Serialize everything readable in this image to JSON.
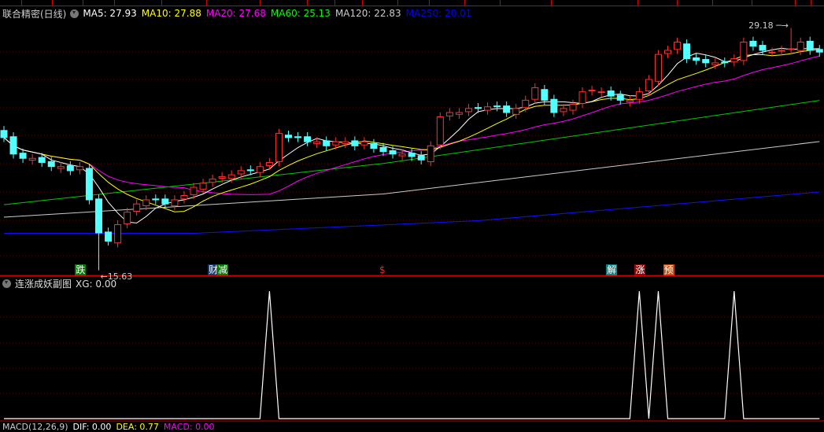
{
  "header": {
    "stock_name": "联合精密(日线)",
    "ma": [
      {
        "label": "MA5: 27.93",
        "color": "#ffffff"
      },
      {
        "label": "MA10: 27.88",
        "color": "#ffff00"
      },
      {
        "label": "MA20: 27.68",
        "color": "#ff00ff"
      },
      {
        "label": "MA60: 25.13",
        "color": "#00ff00"
      },
      {
        "label": "MA120: 22.83",
        "color": "#cccccc"
      },
      {
        "label": "MA250: 20.01",
        "color": "#0000ff"
      }
    ]
  },
  "price_marks": {
    "high": "29.18",
    "low": "15.63",
    "high_index": 83,
    "low_index": 10
  },
  "signals": [
    {
      "text": "跌",
      "bg": "#0a7a0a",
      "index": 8
    },
    {
      "text": "财",
      "bg": "#1a3a6a",
      "index": 22
    },
    {
      "text": "减",
      "bg": "#0a7a0a",
      "index": 23
    },
    {
      "text": "$",
      "bg": "transparent",
      "color": "#ff2020",
      "index": 40
    },
    {
      "text": "解",
      "bg": "#108080",
      "index": 64
    },
    {
      "text": "涨",
      "bg": "#8a0a0a",
      "index": 67
    },
    {
      "text": "预",
      "bg": "#c05010",
      "index": 70
    }
  ],
  "sub_chart": {
    "title": "连涨成妖副图",
    "value_label": "XG: 0.00",
    "xg_on_indices": [
      28,
      67,
      69,
      77
    ]
  },
  "bottom_bar": {
    "items": [
      {
        "label": "MACD(12,26,9)",
        "color": "#cccccc"
      },
      {
        "label": "DIF: 0.00",
        "color": "#ffffff"
      },
      {
        "label": "DEA: 0.77",
        "color": "#ffff00"
      },
      {
        "label": "MACD: 0.00",
        "color": "#ff00ff"
      }
    ]
  },
  "chart_data": {
    "type": "candlestick",
    "y_range": [
      15.3,
      29.6
    ],
    "closes": [
      23.05,
      22.13,
      21.89,
      21.89,
      21.66,
      21.43,
      21.43,
      21.2,
      21.43,
      19.57,
      17.72,
      17.26,
      18.18,
      18.88,
      19.34,
      19.57,
      19.57,
      19.34,
      19.57,
      19.81,
      20.27,
      20.5,
      20.73,
      20.87,
      20.97,
      21.2,
      21.2,
      21.43,
      21.66,
      23.29,
      23.05,
      23.05,
      22.82,
      22.82,
      22.59,
      22.82,
      22.82,
      22.59,
      22.82,
      22.45,
      22.27,
      22.13,
      22.13,
      21.99,
      21.8,
      22.59,
      24.21,
      24.45,
      24.45,
      24.68,
      24.68,
      24.77,
      24.77,
      24.45,
      24.68,
      25.14,
      25.84,
      25.14,
      24.45,
      24.68,
      24.91,
      25.61,
      25.7,
      25.61,
      25.37,
      25.14,
      25.14,
      25.61,
      26.3,
      27.7,
      27.93,
      28.39,
      27.46,
      27.37,
      27.23,
      27.23,
      27.23,
      27.46,
      28.39,
      28.16,
      27.93,
      27.83,
      27.93,
      28.02,
      28.39,
      27.93,
      27.83
    ],
    "ma60": [
      [
        0,
        19.3
      ],
      [
        40,
        21.6
      ],
      [
        86,
        25.13
      ]
    ],
    "ma120": [
      [
        0,
        18.6
      ],
      [
        40,
        19.9
      ],
      [
        86,
        22.83
      ]
    ],
    "ma250": [
      [
        0,
        17.7
      ],
      [
        20,
        17.7
      ],
      [
        50,
        18.4
      ],
      [
        86,
        20.01
      ]
    ]
  }
}
